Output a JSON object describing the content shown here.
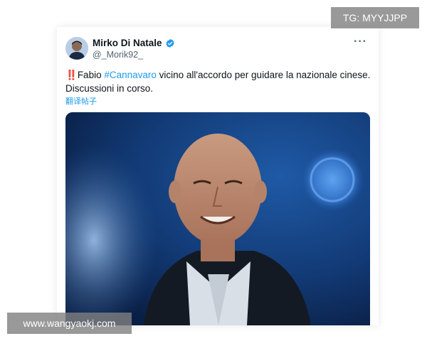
{
  "watermarks": {
    "telegram": "TG: MYYJJPP",
    "site": "www.wangyaokj.com"
  },
  "tweet": {
    "author_name": "Mirko Di Natale",
    "handle": "@_Morik92_",
    "verified": true,
    "more_icon": "ellipsis-icon",
    "text_bang": "‼️",
    "text_before": "Fabio ",
    "hashtag": "#Cannavaro",
    "text_after": " vicino all'accordo per guidare la nazionale cinese. Discussioni in corso.",
    "translate_label": "翻译帖子",
    "media_alt": "Smiling bald man in dark suit jacket with stadium lights behind"
  },
  "colors": {
    "link": "#1d9bf0",
    "text": "#0f1419",
    "muted": "#536471",
    "verified_badge": "#1d9bf0",
    "emoji_red": "#d81b2b"
  }
}
